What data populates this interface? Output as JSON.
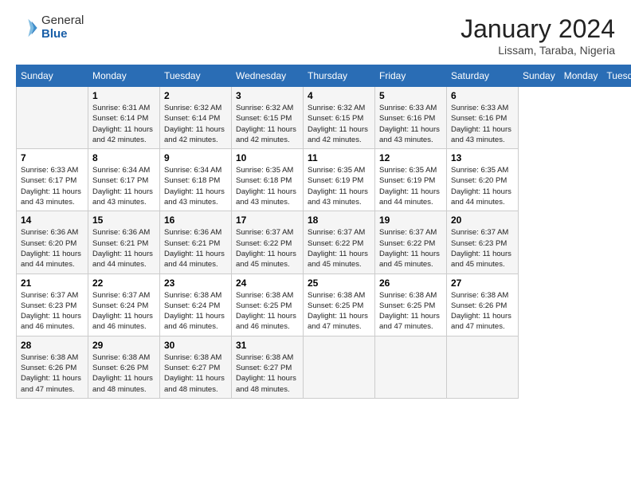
{
  "logo": {
    "general": "General",
    "blue": "Blue"
  },
  "header": {
    "title": "January 2024",
    "subtitle": "Lissam, Taraba, Nigeria"
  },
  "days_of_week": [
    "Sunday",
    "Monday",
    "Tuesday",
    "Wednesday",
    "Thursday",
    "Friday",
    "Saturday"
  ],
  "weeks": [
    [
      {
        "day": "",
        "info": ""
      },
      {
        "day": "1",
        "info": "Sunrise: 6:31 AM\nSunset: 6:14 PM\nDaylight: 11 hours\nand 42 minutes."
      },
      {
        "day": "2",
        "info": "Sunrise: 6:32 AM\nSunset: 6:14 PM\nDaylight: 11 hours\nand 42 minutes."
      },
      {
        "day": "3",
        "info": "Sunrise: 6:32 AM\nSunset: 6:15 PM\nDaylight: 11 hours\nand 42 minutes."
      },
      {
        "day": "4",
        "info": "Sunrise: 6:32 AM\nSunset: 6:15 PM\nDaylight: 11 hours\nand 42 minutes."
      },
      {
        "day": "5",
        "info": "Sunrise: 6:33 AM\nSunset: 6:16 PM\nDaylight: 11 hours\nand 43 minutes."
      },
      {
        "day": "6",
        "info": "Sunrise: 6:33 AM\nSunset: 6:16 PM\nDaylight: 11 hours\nand 43 minutes."
      }
    ],
    [
      {
        "day": "7",
        "info": "Sunrise: 6:33 AM\nSunset: 6:17 PM\nDaylight: 11 hours\nand 43 minutes."
      },
      {
        "day": "8",
        "info": "Sunrise: 6:34 AM\nSunset: 6:17 PM\nDaylight: 11 hours\nand 43 minutes."
      },
      {
        "day": "9",
        "info": "Sunrise: 6:34 AM\nSunset: 6:18 PM\nDaylight: 11 hours\nand 43 minutes."
      },
      {
        "day": "10",
        "info": "Sunrise: 6:35 AM\nSunset: 6:18 PM\nDaylight: 11 hours\nand 43 minutes."
      },
      {
        "day": "11",
        "info": "Sunrise: 6:35 AM\nSunset: 6:19 PM\nDaylight: 11 hours\nand 43 minutes."
      },
      {
        "day": "12",
        "info": "Sunrise: 6:35 AM\nSunset: 6:19 PM\nDaylight: 11 hours\nand 44 minutes."
      },
      {
        "day": "13",
        "info": "Sunrise: 6:35 AM\nSunset: 6:20 PM\nDaylight: 11 hours\nand 44 minutes."
      }
    ],
    [
      {
        "day": "14",
        "info": "Sunrise: 6:36 AM\nSunset: 6:20 PM\nDaylight: 11 hours\nand 44 minutes."
      },
      {
        "day": "15",
        "info": "Sunrise: 6:36 AM\nSunset: 6:21 PM\nDaylight: 11 hours\nand 44 minutes."
      },
      {
        "day": "16",
        "info": "Sunrise: 6:36 AM\nSunset: 6:21 PM\nDaylight: 11 hours\nand 44 minutes."
      },
      {
        "day": "17",
        "info": "Sunrise: 6:37 AM\nSunset: 6:22 PM\nDaylight: 11 hours\nand 45 minutes."
      },
      {
        "day": "18",
        "info": "Sunrise: 6:37 AM\nSunset: 6:22 PM\nDaylight: 11 hours\nand 45 minutes."
      },
      {
        "day": "19",
        "info": "Sunrise: 6:37 AM\nSunset: 6:22 PM\nDaylight: 11 hours\nand 45 minutes."
      },
      {
        "day": "20",
        "info": "Sunrise: 6:37 AM\nSunset: 6:23 PM\nDaylight: 11 hours\nand 45 minutes."
      }
    ],
    [
      {
        "day": "21",
        "info": "Sunrise: 6:37 AM\nSunset: 6:23 PM\nDaylight: 11 hours\nand 46 minutes."
      },
      {
        "day": "22",
        "info": "Sunrise: 6:37 AM\nSunset: 6:24 PM\nDaylight: 11 hours\nand 46 minutes."
      },
      {
        "day": "23",
        "info": "Sunrise: 6:38 AM\nSunset: 6:24 PM\nDaylight: 11 hours\nand 46 minutes."
      },
      {
        "day": "24",
        "info": "Sunrise: 6:38 AM\nSunset: 6:25 PM\nDaylight: 11 hours\nand 46 minutes."
      },
      {
        "day": "25",
        "info": "Sunrise: 6:38 AM\nSunset: 6:25 PM\nDaylight: 11 hours\nand 47 minutes."
      },
      {
        "day": "26",
        "info": "Sunrise: 6:38 AM\nSunset: 6:25 PM\nDaylight: 11 hours\nand 47 minutes."
      },
      {
        "day": "27",
        "info": "Sunrise: 6:38 AM\nSunset: 6:26 PM\nDaylight: 11 hours\nand 47 minutes."
      }
    ],
    [
      {
        "day": "28",
        "info": "Sunrise: 6:38 AM\nSunset: 6:26 PM\nDaylight: 11 hours\nand 47 minutes."
      },
      {
        "day": "29",
        "info": "Sunrise: 6:38 AM\nSunset: 6:26 PM\nDaylight: 11 hours\nand 48 minutes."
      },
      {
        "day": "30",
        "info": "Sunrise: 6:38 AM\nSunset: 6:27 PM\nDaylight: 11 hours\nand 48 minutes."
      },
      {
        "day": "31",
        "info": "Sunrise: 6:38 AM\nSunset: 6:27 PM\nDaylight: 11 hours\nand 48 minutes."
      },
      {
        "day": "",
        "info": ""
      },
      {
        "day": "",
        "info": ""
      },
      {
        "day": "",
        "info": ""
      }
    ]
  ]
}
